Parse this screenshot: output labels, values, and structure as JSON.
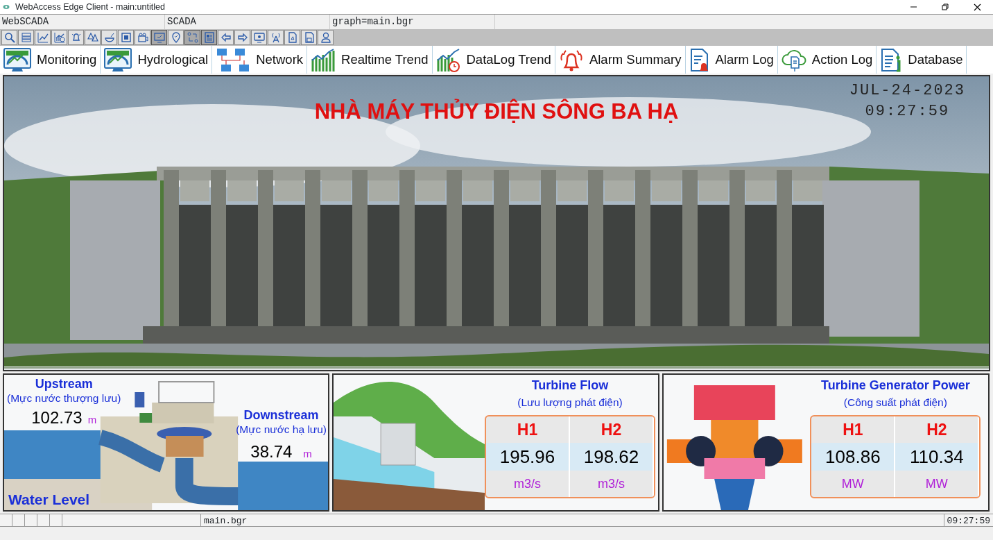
{
  "window": {
    "title": "WebAccess Edge Client - main:untitled"
  },
  "address_bar": [
    "WebSCADA",
    "SCADA",
    "graph=main.bgr"
  ],
  "toolbar": [
    {
      "pressed": false
    },
    {
      "pressed": false
    },
    {
      "pressed": false
    },
    {
      "pressed": false
    },
    {
      "pressed": false
    },
    {
      "pressed": false
    },
    {
      "pressed": false
    },
    {
      "pressed": false
    },
    {
      "pressed": false
    },
    {
      "pressed": true
    },
    {
      "pressed": false
    },
    {
      "pressed": true
    },
    {
      "pressed": true
    },
    {
      "pressed": false
    },
    {
      "pressed": false
    },
    {
      "pressed": false
    },
    {
      "pressed": false
    },
    {
      "pressed": false
    },
    {
      "pressed": false
    },
    {
      "pressed": false
    }
  ],
  "nav": [
    {
      "label": "Monitoring"
    },
    {
      "label": "Hydrological"
    },
    {
      "label": "Network"
    },
    {
      "label": "Realtime Trend"
    },
    {
      "label": "DataLog Trend"
    },
    {
      "label": "Alarm Summary"
    },
    {
      "label": "Alarm Log"
    },
    {
      "label": "Action Log"
    },
    {
      "label": "Database"
    }
  ],
  "banner": {
    "title": "NHÀ MÁY THỦY ĐIỆN SÔNG BA HẠ",
    "date": "JUL-24-2023",
    "time": "09:27:59"
  },
  "water_level": {
    "upstream": {
      "title": "Upstream",
      "subtitle": "(Mực nước thượng lưu)",
      "value": "102.73",
      "unit": "m"
    },
    "downstream": {
      "title": "Downstream",
      "subtitle": "(Mực nước hạ lưu)",
      "value": "38.74",
      "unit": "m"
    },
    "caption": "Water Level"
  },
  "turbine_flow": {
    "title": "Turbine Flow",
    "subtitle": "(Lưu lượng phát điện)",
    "units": [
      {
        "name": "H1",
        "value": "195.96",
        "unit": "m3/s"
      },
      {
        "name": "H2",
        "value": "198.62",
        "unit": "m3/s"
      }
    ]
  },
  "generator_power": {
    "title": "Turbine Generator Power",
    "subtitle": "(Công suất phát điện)",
    "units": [
      {
        "name": "H1",
        "value": "108.86",
        "unit": "MW"
      },
      {
        "name": "H2",
        "value": "110.34",
        "unit": "MW"
      }
    ]
  },
  "status_bar": {
    "file": "main.bgr",
    "time": "09:27:59"
  }
}
